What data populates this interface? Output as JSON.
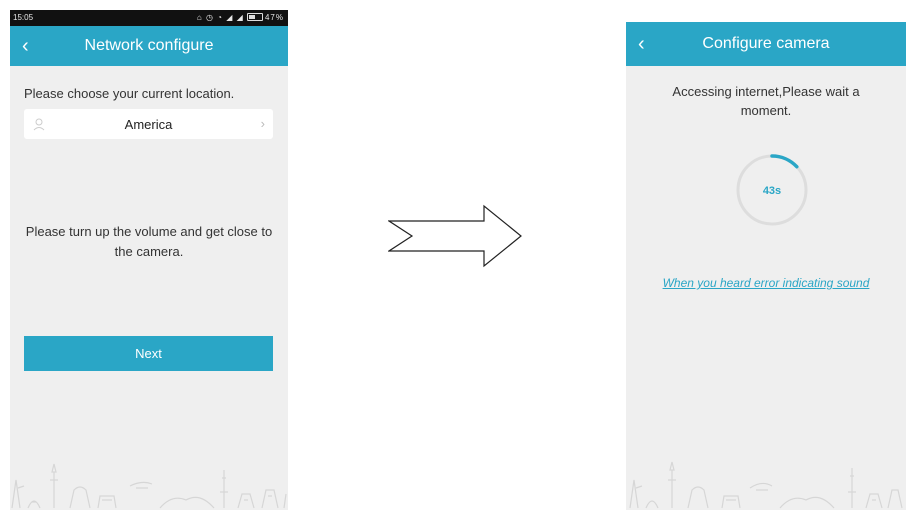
{
  "left_screen": {
    "status": {
      "time": "15:05",
      "icons": "⌂ ◷ ◔ ◢ ◢",
      "battery": "47%"
    },
    "header": {
      "back_icon": "chevron-left-icon",
      "title": "Network configure"
    },
    "location": {
      "prompt": "Please choose your current location.",
      "value": "America"
    },
    "volume_message": "Please turn up the volume and get close to the camera.",
    "next_label": "Next"
  },
  "right_screen": {
    "header": {
      "back_icon": "chevron-left-icon",
      "title": "Configure camera"
    },
    "wait_message": "Accessing internet,Please wait a moment.",
    "countdown": {
      "label": "43s",
      "progress_fraction": 0.13
    },
    "error_link": "When you heard error indicating sound"
  },
  "colors": {
    "accent": "#2aa6c6",
    "screen_bg": "#efefef"
  }
}
